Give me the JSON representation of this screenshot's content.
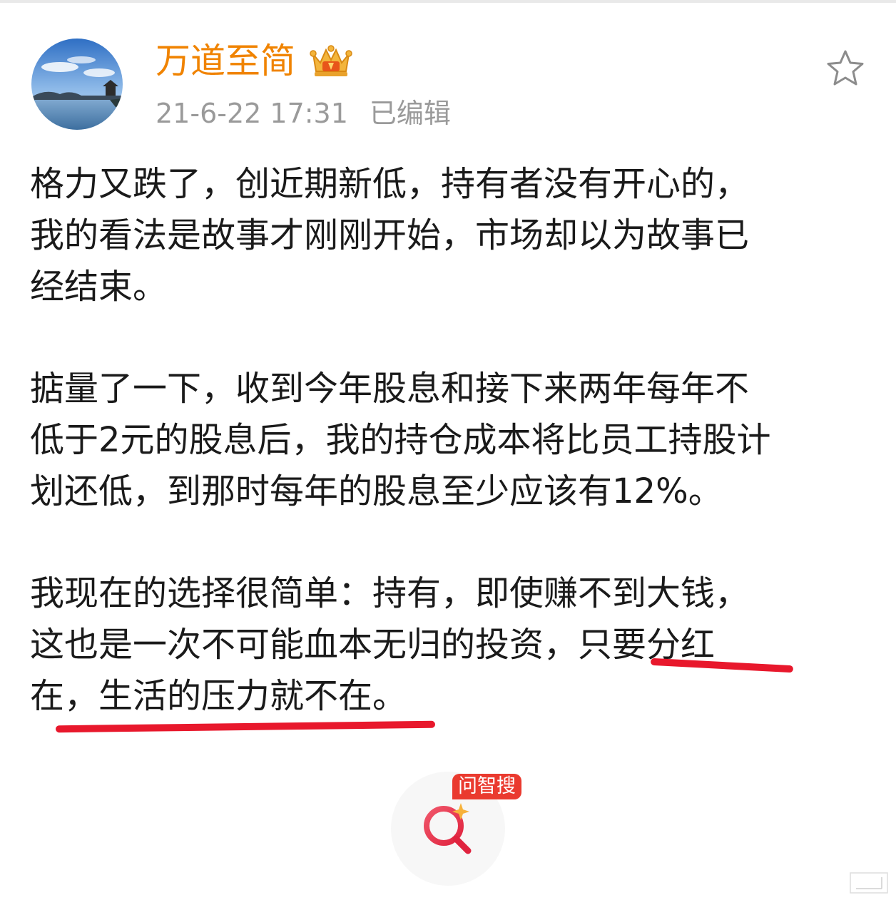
{
  "user": {
    "name": "万道至简",
    "badge_icon": "crown-icon"
  },
  "post": {
    "timestamp": "21-6-22 17:31",
    "edited_label": "已编辑",
    "paragraphs": [
      {
        "lines": [
          "格力又跌了，创近期新低，持有者没有开心的，",
          "我的看法是故事才刚刚开始，市场却以为故事已",
          "经结束。"
        ]
      },
      {
        "lines": [
          "掂量了一下，收到今年股息和接下来两年每年不",
          "低于2元的股息后，我的持仓成本将比员工持股计",
          "划还低，到那时每年的股息至少应该有12%。"
        ]
      },
      {
        "lines": [
          "我现在的选择很简单：持有，即使赚不到大钱，",
          "这也是一次不可能血本无归的投资，只要分红",
          "在，生活的压力就不在。"
        ]
      }
    ],
    "highlight_color": "#e8182c"
  },
  "actions": {
    "favorite_icon": "star-icon"
  },
  "search_fab": {
    "badge": "问智搜",
    "icon": "ai-search-icon"
  },
  "colors": {
    "username": "#f08300",
    "meta": "#9a9a9a",
    "body_text": "#1a1a1a",
    "badge_bg": "#ea3a2f"
  }
}
